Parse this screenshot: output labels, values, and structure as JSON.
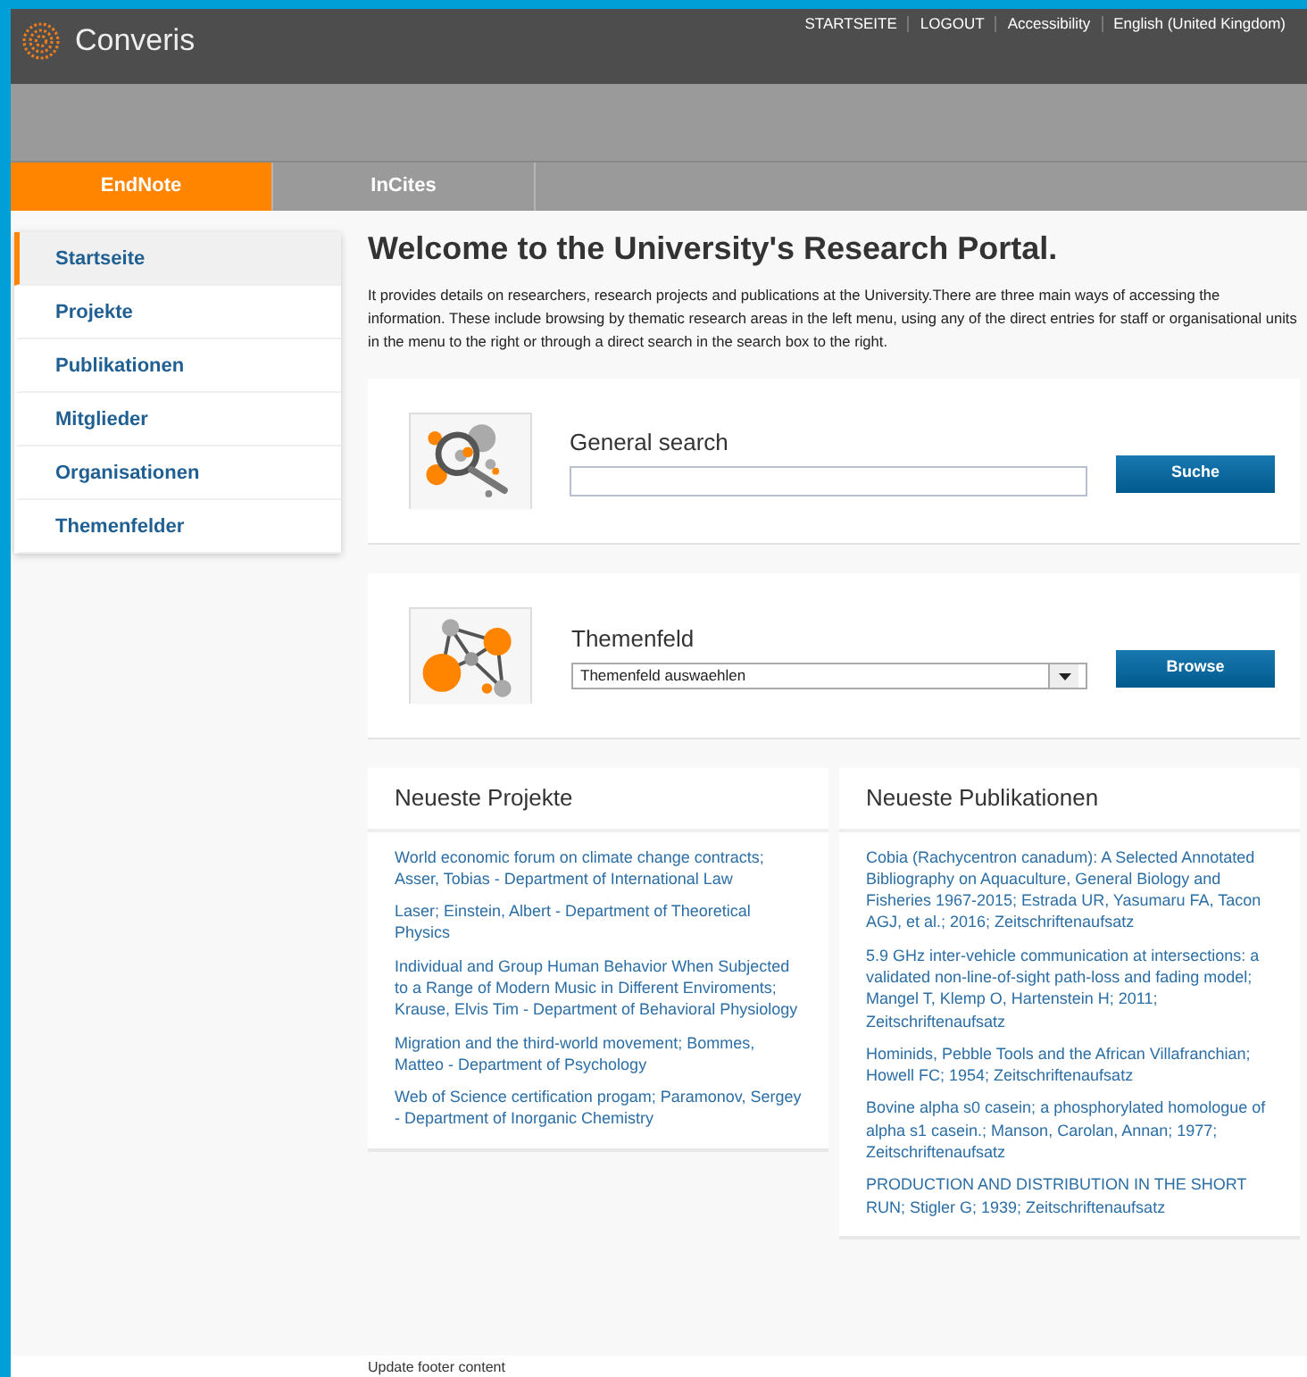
{
  "header": {
    "logo_text": "Converis",
    "top_links": [
      "STARTSEITE",
      "LOGOUT",
      "Accessibility",
      "English (United Kingdom)"
    ]
  },
  "tabs": [
    {
      "label": "EndNote",
      "selected": true
    },
    {
      "label": "InCites",
      "selected": false
    }
  ],
  "sidebar": {
    "items": [
      {
        "label": "Startseite",
        "selected": true
      },
      {
        "label": "Projekte",
        "selected": false
      },
      {
        "label": "Publikationen",
        "selected": false
      },
      {
        "label": "Mitglieder",
        "selected": false
      },
      {
        "label": "Organisationen",
        "selected": false
      },
      {
        "label": "Themenfelder",
        "selected": false
      }
    ]
  },
  "welcome": {
    "title": "Welcome to the University's Research Portal.",
    "text": "It provides details on researchers, research projects and publications at the University.There are three main ways of accessing the information. These include browsing by thematic research areas in the left menu, using any of the direct entries for staff or organisational units in the menu to the right or through a direct search in the search box to the right."
  },
  "search_panels": [
    {
      "kind": "search",
      "title": "General search",
      "button": "Suche"
    },
    {
      "kind": "select",
      "title": "Themenfeld",
      "value": "Themenfeld auswaehlen",
      "button": "Browse"
    }
  ],
  "lists": [
    {
      "title": "Neueste Projekte",
      "items": [
        "World economic forum on climate change contracts; Asser, Tobias - Department of International Law",
        "Laser; Einstein, Albert - Department of Theoretical Physics",
        "Individual and Group Human Behavior When Subjected to a Range of Modern Music in Different Enviroments; Krause, Elvis Tim - Department of Behavioral Physiology",
        "Migration and the third-world movement; Bommes, Matteo - Department of Psychology",
        "Web of Science certification progam; Paramonov, Sergey - Department of Inorganic Chemistry"
      ]
    },
    {
      "title": "Neueste Publikationen",
      "items": [
        "Cobia (Rachycentron canadum): A Selected Annotated Bibliography on Aquaculture, General Biology and Fisheries 1967-2015; Estrada UR, Yasumaru FA, Tacon AGJ, et al.; 2016; Zeitschriftenaufsatz",
        "5.9 GHz inter-vehicle communication at intersections: a validated non-line-of-sight path-loss and fading model; Mangel T, Klemp O, Hartenstein H; 2011; Zeitschriftenaufsatz",
        "Hominids, Pebble Tools and the African Villafranchian; Howell FC; 1954; Zeitschriftenaufsatz",
        "Bovine alpha s0 casein; a phosphorylated homologue of alpha s1 casein.; Manson, Carolan, Annan; 1977; Zeitschriftenaufsatz",
        "PRODUCTION AND DISTRIBUTION IN THE SHORT RUN; Stigler G; 1939; Zeitschriftenaufsatz"
      ]
    }
  ],
  "footer": {
    "text": "Update footer content"
  }
}
